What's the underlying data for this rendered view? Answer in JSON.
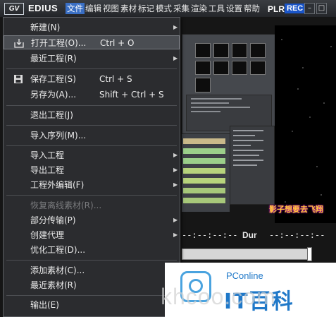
{
  "titlebar": {
    "logo_text": "GV",
    "app_name": "EDIUS",
    "menus": [
      "文件",
      "编辑",
      "视图",
      "素材",
      "标记",
      "模式",
      "采集",
      "渲染",
      "工具",
      "设置",
      "帮助"
    ],
    "plr": "PLR",
    "rec": "REC"
  },
  "file_menu": {
    "items": [
      {
        "label": "新建(N)",
        "shortcut": "",
        "submenu": true
      },
      {
        "label": "打开工程(O)...",
        "shortcut": "Ctrl + O",
        "submenu": false
      },
      {
        "label": "最近工程(R)",
        "shortcut": "",
        "submenu": true
      },
      {
        "label": "保存工程(S)",
        "shortcut": "Ctrl + S",
        "submenu": false
      },
      {
        "label": "另存为(A)...",
        "shortcut": "Shift + Ctrl + S",
        "submenu": false
      },
      {
        "label": "退出工程(J)",
        "shortcut": "",
        "submenu": false
      },
      {
        "label": "导入序列(M)...",
        "shortcut": "",
        "submenu": false
      },
      {
        "label": "导入工程",
        "shortcut": "",
        "submenu": true
      },
      {
        "label": "导出工程",
        "shortcut": "",
        "submenu": true
      },
      {
        "label": "工程外编辑(F)",
        "shortcut": "",
        "submenu": true
      },
      {
        "label": "恢复离线素材(R)...",
        "shortcut": "",
        "submenu": false
      },
      {
        "label": "部分传输(P)",
        "shortcut": "",
        "submenu": true
      },
      {
        "label": "创建代理",
        "shortcut": "",
        "submenu": true
      },
      {
        "label": "优化工程(D)...",
        "shortcut": "",
        "submenu": false
      },
      {
        "label": "添加素材(C)...",
        "shortcut": "",
        "submenu": false
      },
      {
        "label": "最近素材(R)",
        "shortcut": "",
        "submenu": true
      },
      {
        "label": "输出(E)",
        "shortcut": "",
        "submenu": true
      }
    ]
  },
  "player": {
    "tc_in": "--:--:--:--",
    "dur_label": "Dur",
    "tc_out": "--:--:--:--",
    "caption": "影子想要去飞翔"
  },
  "overlay": {
    "brand": "PConline",
    "brand_cn": "IT百科",
    "watermark": "khcoo.com"
  },
  "colors": {
    "menu_bg": "#2b2c2f",
    "highlight": "#4a4d52",
    "active_menu": "#3a6fc4",
    "rec": "#1a55c8",
    "pconline_blue": "#1f78c8"
  }
}
